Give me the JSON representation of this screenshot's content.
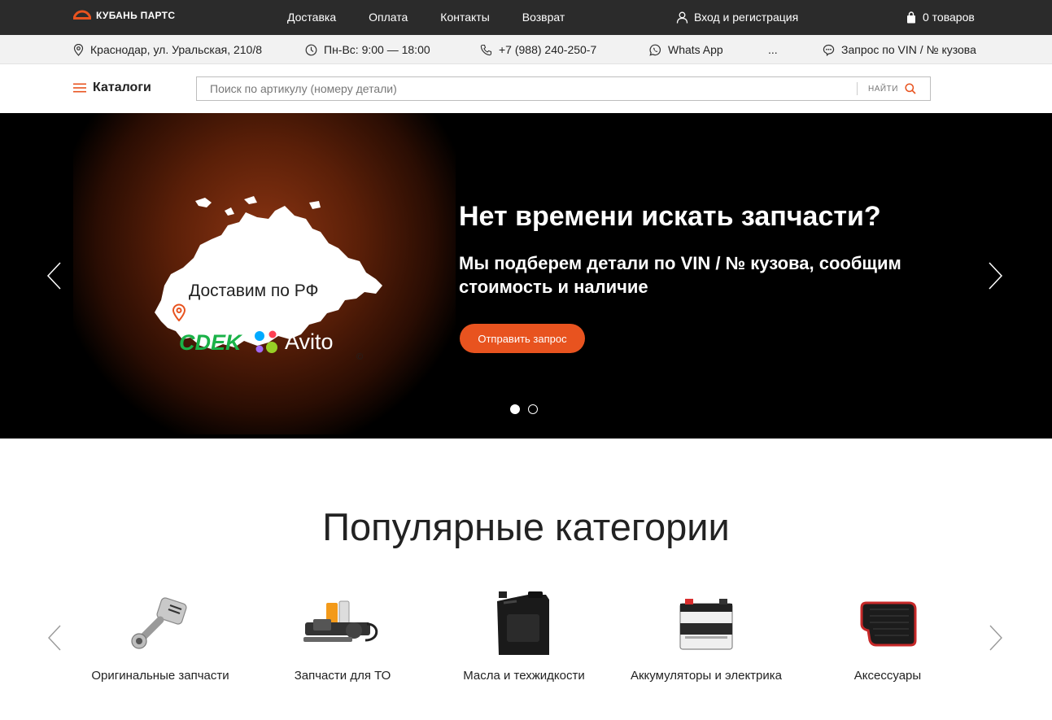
{
  "header": {
    "logo_text": "КУБАНЬ ПАРТС",
    "nav": [
      "Доставка",
      "Оплата",
      "Контакты",
      "Возврат"
    ],
    "login": "Вход и регистрация",
    "cart": "0 товаров"
  },
  "info": {
    "address": "Краснодар, ул. Уральская, 210/8",
    "hours": "Пн-Вс: 9:00 — 18:00",
    "phone": "+7 (988) 240-250-7",
    "whatsapp": "Whats App",
    "more": "...",
    "vin_request": "Запрос по VIN / № кузова"
  },
  "search": {
    "catalogs_label": "Каталоги",
    "placeholder": "Поиск по артикулу (номеру детали)",
    "value": "",
    "button": "НАЙТИ"
  },
  "hero": {
    "map_text": "Доставим по РФ",
    "cdek": "CDEK",
    "avito": "Avito",
    "copyright": "©",
    "title": "Нет времени искать запчасти?",
    "subtitle": "Мы подберем детали по VIN / № кузова, сообщим стоимость и наличие",
    "button": "Отправить запрос",
    "slides_total": 2,
    "active_slide": 1
  },
  "popular": {
    "title": "Популярные категории",
    "items": [
      {
        "label": "Оригинальные запчасти",
        "icon": "piston-icon"
      },
      {
        "label": "Запчасти для ТО",
        "icon": "maintenance-kit-icon"
      },
      {
        "label": "Масла и техжидкости",
        "icon": "oil-canister-icon"
      },
      {
        "label": "Аккумуляторы и электрика",
        "icon": "battery-icon"
      },
      {
        "label": "Аксессуары",
        "icon": "car-mat-icon"
      }
    ]
  },
  "colors": {
    "accent": "#e8531f",
    "topbar": "#2b2b2b",
    "infobar": "#f2f2f2",
    "cdek_green": "#1ab248"
  }
}
